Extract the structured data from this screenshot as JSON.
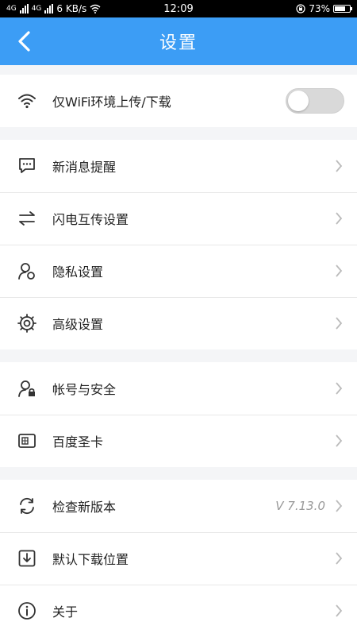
{
  "status_bar": {
    "carrier_left": "4G",
    "carrier_right": "4G",
    "speed": "6 KB/s",
    "time": "12:09",
    "battery": "73%",
    "battery_level": 0.73
  },
  "app_bar": {
    "title": "设置"
  },
  "groups": [
    {
      "items": [
        {
          "label": "仅WiFi环境上传/下载",
          "toggle_on": false
        }
      ]
    },
    {
      "items": [
        {
          "label": "新消息提醒"
        },
        {
          "label": "闪电互传设置"
        },
        {
          "label": "隐私设置"
        },
        {
          "label": "高级设置"
        }
      ]
    },
    {
      "items": [
        {
          "label": "帐号与安全"
        },
        {
          "label": "百度圣卡"
        }
      ]
    },
    {
      "items": [
        {
          "label": "检查新版本",
          "value": "V 7.13.0"
        },
        {
          "label": "默认下载位置"
        },
        {
          "label": "关于"
        }
      ]
    }
  ],
  "colors": {
    "accent": "#3c9df5",
    "background": "#f4f5f7",
    "divider": "#e8e8e8"
  }
}
